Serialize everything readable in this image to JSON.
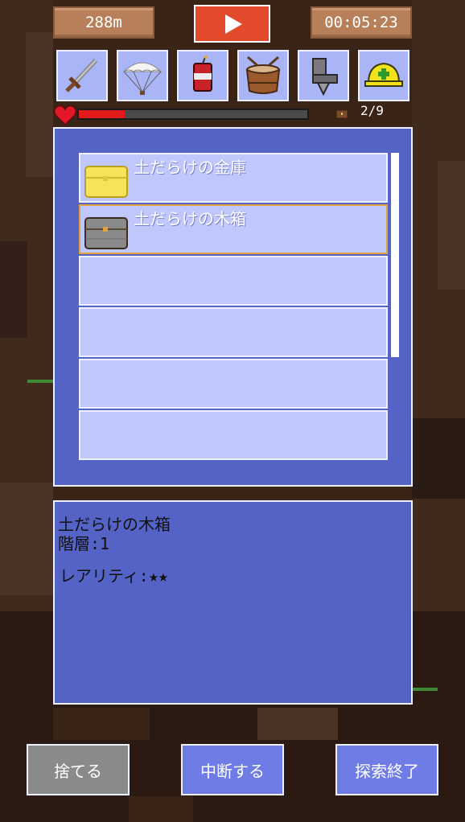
{
  "hud": {
    "depth": "288m",
    "timer": "00:05:23",
    "item_count": "2/9",
    "hp_fraction": 0.2
  },
  "toolbar": [
    {
      "name": "sword"
    },
    {
      "name": "parachute"
    },
    {
      "name": "dynamite"
    },
    {
      "name": "drum"
    },
    {
      "name": "drill-boot"
    },
    {
      "name": "helmet"
    }
  ],
  "inventory": {
    "items": [
      {
        "label": "土だらけの金庫",
        "icon": "gold-chest"
      },
      {
        "label": "土だらけの木箱",
        "icon": "wood-chest",
        "selected": true
      },
      {
        "label": ""
      },
      {
        "label": ""
      },
      {
        "label": ""
      },
      {
        "label": ""
      }
    ]
  },
  "detail": {
    "name": "土だらけの木箱",
    "floor": "階層:1",
    "rarity": "レアリティ:★★"
  },
  "buttons": {
    "discard": "捨てる",
    "pause": "中断する",
    "finish": "探索終了"
  },
  "colors": {
    "panel": "#5562c6",
    "slot": "#a9b5f7",
    "row": "#c0c8fb",
    "play": "#e34a2b",
    "hp": "#e11b1b",
    "discard_btn": "#8a8a8a",
    "action_btn": "#6f7ce6"
  }
}
